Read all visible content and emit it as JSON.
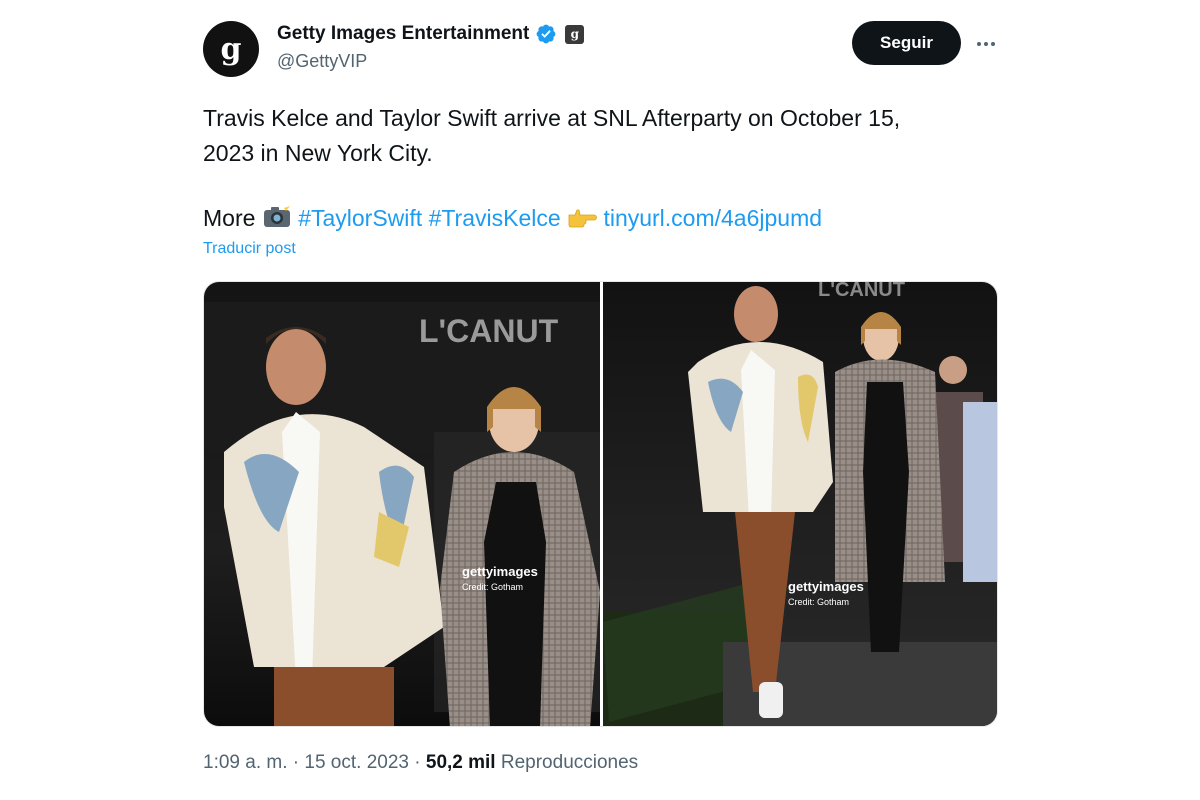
{
  "account": {
    "avatar_letter": "g",
    "display_name": "Getty Images Entertainment",
    "affiliate_badge": "g",
    "handle": "@GettyVIP"
  },
  "actions": {
    "follow_label": "Seguir"
  },
  "tweet": {
    "text_line1": "Travis Kelce and Taylor Swift arrive at SNL Afterparty on October 15,",
    "text_line2": "2023 in New York City.",
    "more_label": "More",
    "hashtag1": "#TaylorSwift",
    "hashtag2": "#TravisKelce",
    "link": "tinyurl.com/4a6jpumd",
    "translate_label": "Traducir post"
  },
  "media": {
    "photo1": {
      "sign": "L'CANUT",
      "watermark": "gettyimages",
      "credit": "Credit: Gotham"
    },
    "photo2": {
      "sign": "L'CANUT",
      "watermark": "gettyimages",
      "credit": "Credit: Gotham"
    }
  },
  "meta": {
    "time": "1:09 a. m.",
    "sep1": " · ",
    "date": "15 oct. 2023",
    "sep2": " · ",
    "views": "50,2 mil",
    "views_label": "Reproducciones"
  },
  "colors": {
    "link": "#1d9bf0",
    "verified": "#1d9bf0",
    "muted": "#536471",
    "follow_bg": "#0f1419"
  },
  "icons": {
    "verified": "verified-badge-icon",
    "affiliate": "affiliate-badge-icon",
    "more": "more-dots-icon",
    "camera": "camera-flash-emoji",
    "pointing": "pointing-right-emoji"
  }
}
